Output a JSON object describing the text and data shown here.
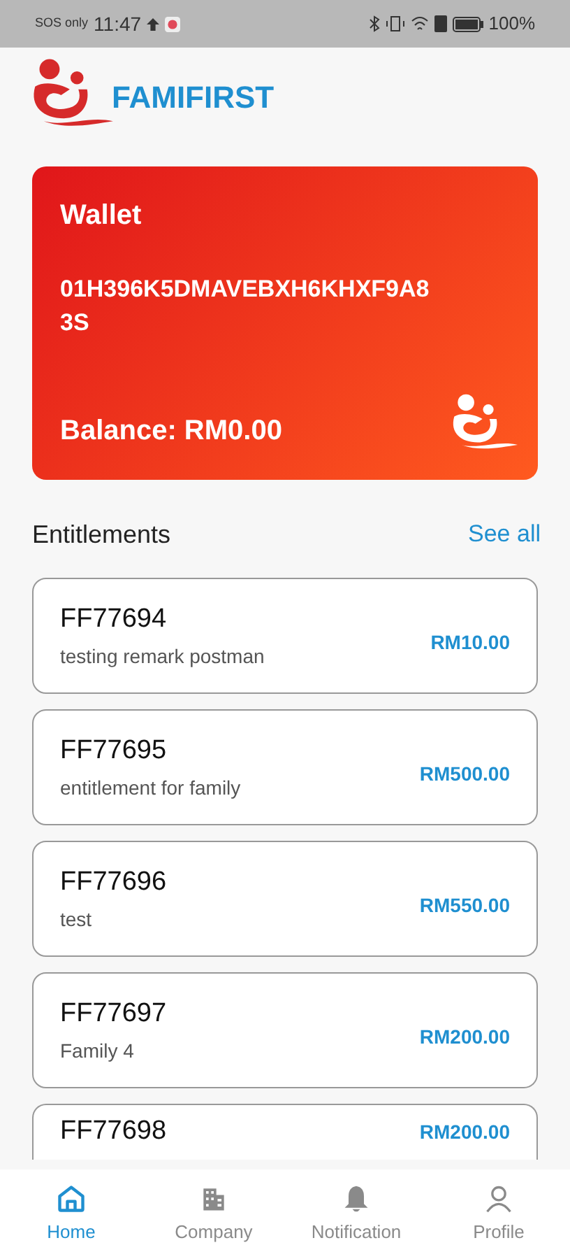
{
  "status_bar": {
    "carrier": "SOS only",
    "time": "11:47",
    "battery": "100%"
  },
  "header": {
    "brand": "FAMIFIRST"
  },
  "wallet": {
    "title": "Wallet",
    "id": "01H396K5DMAVEBXH6KHXF9A83S",
    "balance": "Balance: RM0.00"
  },
  "entitlements": {
    "title": "Entitlements",
    "see_all": "See all",
    "items": [
      {
        "code": "FF77694",
        "remark": "testing remark postman",
        "amount": "RM10.00"
      },
      {
        "code": "FF77695",
        "remark": "entitlement for family",
        "amount": "RM500.00"
      },
      {
        "code": "FF77696",
        "remark": "test",
        "amount": "RM550.00"
      },
      {
        "code": "FF77697",
        "remark": "Family 4",
        "amount": "RM200.00"
      },
      {
        "code": "FF77698",
        "amount": "RM200.00"
      }
    ]
  },
  "bottom_nav": [
    {
      "label": "Home",
      "kind": "home",
      "selected": true
    },
    {
      "label": "Company",
      "kind": "company",
      "selected": false
    },
    {
      "label": "Notification",
      "kind": "bell",
      "selected": false
    },
    {
      "label": "Profile",
      "kind": "person",
      "selected": false
    }
  ]
}
